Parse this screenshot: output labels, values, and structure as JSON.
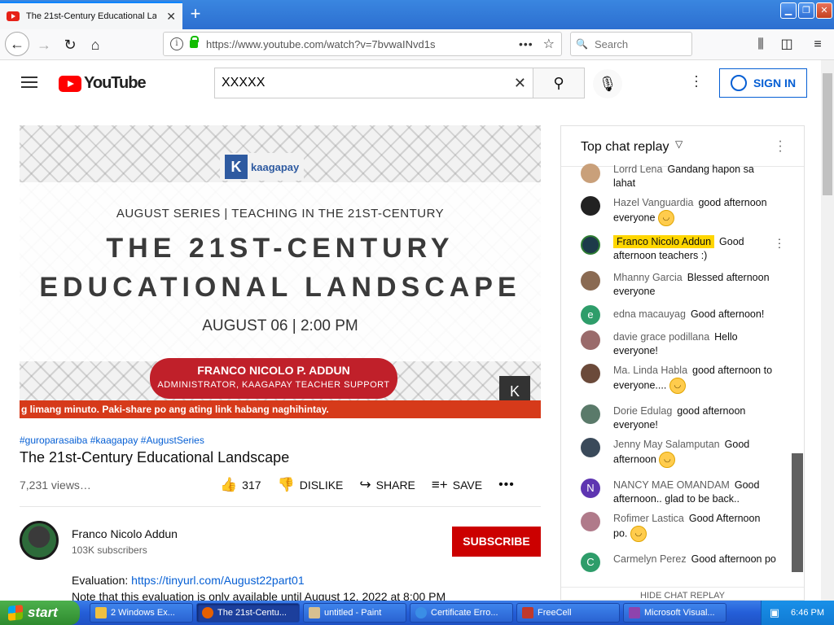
{
  "browser": {
    "tab_title": "The 21st-Century Educational Lan",
    "url": "https://www.youtube.com/watch?v=7bvwaINvd1s",
    "search_placeholder": "Search"
  },
  "youtube": {
    "logo_text": "YouTube",
    "search_value": "XXXXX",
    "signin_label": "SIGN IN"
  },
  "video": {
    "brand": "kaagapay",
    "series": "AUGUST SERIES | TEACHING IN THE 21ST-CENTURY",
    "title_line1": "THE 21ST-CENTURY",
    "title_line2": "EDUCATIONAL LANDSCAPE",
    "date": "AUGUST 06 | 2:00 PM",
    "presenter": "FRANCO NICOLO P. ADDUN",
    "presenter_role": "ADMINISTRATOR, KAAGAPAY TEACHER SUPPORT",
    "ticker": "g limang minuto. Paki-share po ang ating link habang naghihintay."
  },
  "info": {
    "hashtags": "#guroparasaiba #kaagapay #AugustSeries",
    "title": "The 21st-Century Educational Landscape",
    "views": "7,231 views…",
    "likes": "317",
    "dislike_label": "DISLIKE",
    "share_label": "SHARE",
    "save_label": "SAVE"
  },
  "channel": {
    "name": "Franco Nicolo Addun",
    "subscribers": "103K subscribers",
    "subscribe_label": "SUBSCRIBE",
    "desc_label": "Evaluation: ",
    "desc_link": "https://tinyurl.com/August22part01",
    "desc_note": "Note that this evaluation is only available until August 12, 2022 at 8:00 PM"
  },
  "chat": {
    "title": "Top chat replay",
    "footer": "HIDE CHAT REPLAY",
    "messages": [
      {
        "author": "Lorrd Lena",
        "text": "Gandang hapon sa lahat"
      },
      {
        "author": "Hazel Vanguardia",
        "text": "good afternoon everyone"
      },
      {
        "author": "Franco Nicolo Addun",
        "text": "Good afternoon teachers :)"
      },
      {
        "author": "Mhanny Garcia",
        "text": "Blessed afternoon everyone"
      },
      {
        "author": "edna macauyag",
        "text": "Good afternoon!"
      },
      {
        "author": "davie grace podillana",
        "text": "Hello everyone!"
      },
      {
        "author": "Ma. Linda Habla",
        "text": "good afternoon to everyone...."
      },
      {
        "author": "Dorie Edulag",
        "text": "good afternoon everyone!"
      },
      {
        "author": "Jenny May Salamputan",
        "text": "Good afternoon"
      },
      {
        "author": "NANCY MAE OMANDAM",
        "text": "Good afternoon.. glad to be back.."
      },
      {
        "author": "Rofimer Lastica",
        "text": "Good Afternoon po."
      },
      {
        "author": "Carmelyn Perez",
        "text": "Good afternoon po"
      }
    ]
  },
  "taskbar": {
    "start_label": "start",
    "tasks": [
      "2 Windows Ex...",
      "The 21st-Centu...",
      "untitled - Paint",
      "Certificate Erro...",
      "FreeCell",
      "Microsoft Visual..."
    ],
    "clock": "6:46 PM"
  }
}
